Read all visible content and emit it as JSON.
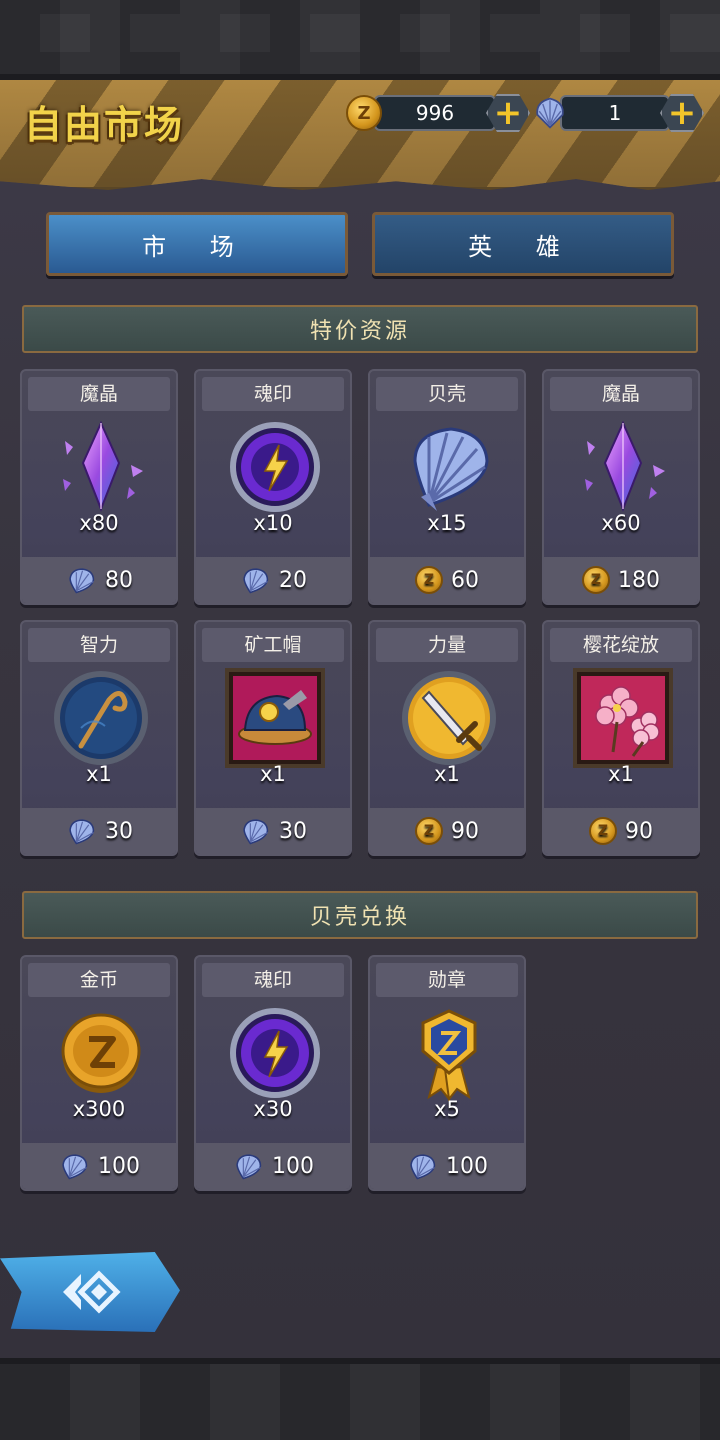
{
  "header": {
    "title": "自由市场",
    "coins": "996",
    "shells": "1",
    "coin_symbol": "Z"
  },
  "tabs": [
    {
      "label": "市 场",
      "active": true
    },
    {
      "label": "英 雄",
      "active": false
    }
  ],
  "sections": {
    "specials_title": "特价资源",
    "exchange_title": "贝壳兑换"
  },
  "specials": [
    {
      "name": "魔晶",
      "qty": "x80",
      "icon": "crystal-icon",
      "currency": "shell",
      "price": "80"
    },
    {
      "name": "魂印",
      "qty": "x10",
      "icon": "soul-seal-icon",
      "currency": "shell",
      "price": "20"
    },
    {
      "name": "贝壳",
      "qty": "x15",
      "icon": "shell-icon",
      "currency": "coin",
      "price": "60"
    },
    {
      "name": "魔晶",
      "qty": "x60",
      "icon": "crystal-icon",
      "currency": "coin",
      "price": "180"
    },
    {
      "name": "智力",
      "qty": "x1",
      "icon": "staff-icon",
      "currency": "shell",
      "price": "30"
    },
    {
      "name": "矿工帽",
      "qty": "x1",
      "icon": "miner-hat-icon",
      "currency": "shell",
      "price": "30"
    },
    {
      "name": "力量",
      "qty": "x1",
      "icon": "sword-icon",
      "currency": "coin",
      "price": "90"
    },
    {
      "name": "樱花绽放",
      "qty": "x1",
      "icon": "cherry-blossom-icon",
      "currency": "coin",
      "price": "90"
    }
  ],
  "exchange": [
    {
      "name": "金币",
      "qty": "x300",
      "icon": "gold-coin-icon",
      "currency": "shell",
      "price": "100"
    },
    {
      "name": "魂印",
      "qty": "x30",
      "icon": "soul-seal-icon",
      "currency": "shell",
      "price": "100"
    },
    {
      "name": "勋章",
      "qty": "x5",
      "icon": "medal-icon",
      "currency": "shell",
      "price": "100"
    }
  ],
  "colors": {
    "title_gold": "#f2d34a",
    "tab_active": "#4b8fc8",
    "panel": "#3d3a48"
  }
}
